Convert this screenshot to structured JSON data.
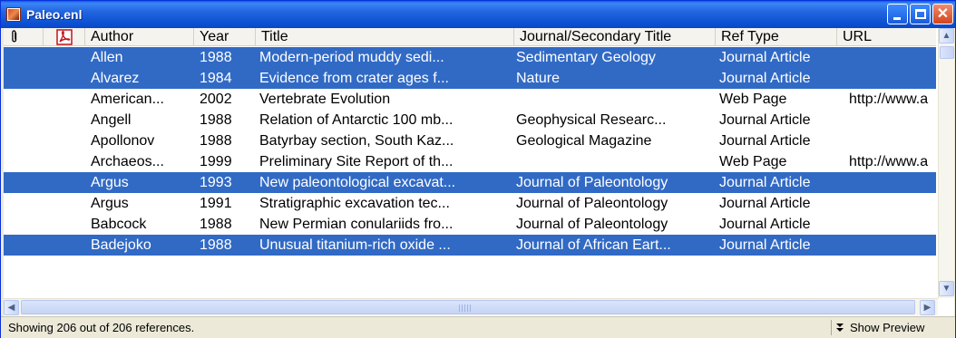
{
  "window": {
    "title": "Paleo.enl"
  },
  "columns": {
    "author": "Author",
    "year": "Year",
    "title": "Title",
    "journal": "Journal/Secondary Title",
    "reftype": "Ref Type",
    "url": "URL"
  },
  "rows": [
    {
      "author": "Allen",
      "year": "1988",
      "title": "Modern-period muddy sedi...",
      "journal": "Sedimentary Geology",
      "reftype": "Journal Article",
      "url": "",
      "selected": true
    },
    {
      "author": "Alvarez",
      "year": "1984",
      "title": "Evidence from crater ages f...",
      "journal": "Nature",
      "reftype": "Journal Article",
      "url": "",
      "selected": true
    },
    {
      "author": "American...",
      "year": "2002",
      "title": "Vertebrate Evolution",
      "journal": "",
      "reftype": "Web Page",
      "url": "http://www.a",
      "selected": false
    },
    {
      "author": "Angell",
      "year": "1988",
      "title": "Relation of Antarctic 100 mb...",
      "journal": "Geophysical Researc...",
      "reftype": "Journal Article",
      "url": "",
      "selected": false
    },
    {
      "author": "Apollonov",
      "year": "1988",
      "title": "Batyrbay section, South Kaz...",
      "journal": "Geological Magazine",
      "reftype": "Journal Article",
      "url": "",
      "selected": false
    },
    {
      "author": "Archaeos...",
      "year": "1999",
      "title": "Preliminary Site Report of th...",
      "journal": "",
      "reftype": "Web Page",
      "url": "http://www.a",
      "selected": false
    },
    {
      "author": "Argus",
      "year": "1993",
      "title": "New paleontological excavat...",
      "journal": "Journal of Paleontology",
      "reftype": "Journal Article",
      "url": "",
      "selected": true
    },
    {
      "author": "Argus",
      "year": "1991",
      "title": "Stratigraphic excavation tec...",
      "journal": "Journal of Paleontology",
      "reftype": "Journal Article",
      "url": "",
      "selected": false
    },
    {
      "author": "Babcock",
      "year": "1988",
      "title": "New Permian conulariids fro...",
      "journal": "Journal of Paleontology",
      "reftype": "Journal Article",
      "url": "",
      "selected": false
    },
    {
      "author": "Badejoko",
      "year": "1988",
      "title": "Unusual titanium-rich oxide ...",
      "journal": "Journal of African Eart...",
      "reftype": "Journal Article",
      "url": "",
      "selected": true
    }
  ],
  "status": {
    "text": "Showing 206 out of 206 references.",
    "preview_label": "Show Preview"
  },
  "colors": {
    "selection": "#316ac5",
    "titlebar": "#0b4fd1"
  },
  "icons": [
    "paperclip-icon",
    "pdf-icon",
    "scroll-up-icon",
    "scroll-down-icon",
    "scroll-left-icon",
    "scroll-right-icon",
    "show-preview-icon"
  ]
}
